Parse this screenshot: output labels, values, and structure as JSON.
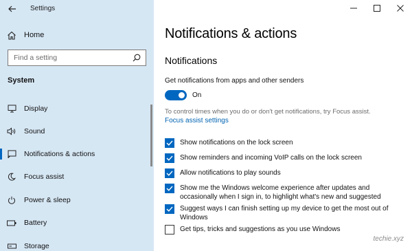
{
  "window": {
    "title": "Settings",
    "controls": [
      "minimize-icon",
      "maximize-icon",
      "close-icon"
    ]
  },
  "sidebar": {
    "home_label": "Home",
    "search_placeholder": "Find a setting",
    "section_label": "System",
    "items": [
      {
        "label": "Display",
        "icon": "display-icon",
        "active": false
      },
      {
        "label": "Sound",
        "icon": "sound-icon",
        "active": false
      },
      {
        "label": "Notifications & actions",
        "icon": "notifications-icon",
        "active": true
      },
      {
        "label": "Focus assist",
        "icon": "focus-assist-icon",
        "active": false
      },
      {
        "label": "Power & sleep",
        "icon": "power-icon",
        "active": false
      },
      {
        "label": "Battery",
        "icon": "battery-icon",
        "active": false
      },
      {
        "label": "Storage",
        "icon": "storage-icon",
        "active": false
      }
    ]
  },
  "main": {
    "page_title": "Notifications & actions",
    "section_title": "Notifications",
    "toggle_description": "Get notifications from apps and other senders",
    "toggle_state": "On",
    "hint": "To control times when you do or don't get notifications, try Focus assist.",
    "link": "Focus assist settings",
    "checkboxes": [
      {
        "label": "Show notifications on the lock screen",
        "checked": true
      },
      {
        "label": "Show reminders and incoming VoIP calls on the lock screen",
        "checked": true
      },
      {
        "label": "Allow notifications to play sounds",
        "checked": true
      },
      {
        "label": "Show me the Windows welcome experience after updates and occasionally when I sign in, to highlight what's new and suggested",
        "checked": true
      },
      {
        "label": "Suggest ways I can finish setting up my device to get the most out of Windows",
        "checked": true
      },
      {
        "label": "Get tips, tricks and suggestions as you use Windows",
        "checked": false
      }
    ]
  },
  "watermark": "techie.xyz",
  "colors": {
    "sidebar_bg": "#d6e7f4",
    "accent": "#0067c0",
    "link": "#0063b1"
  }
}
